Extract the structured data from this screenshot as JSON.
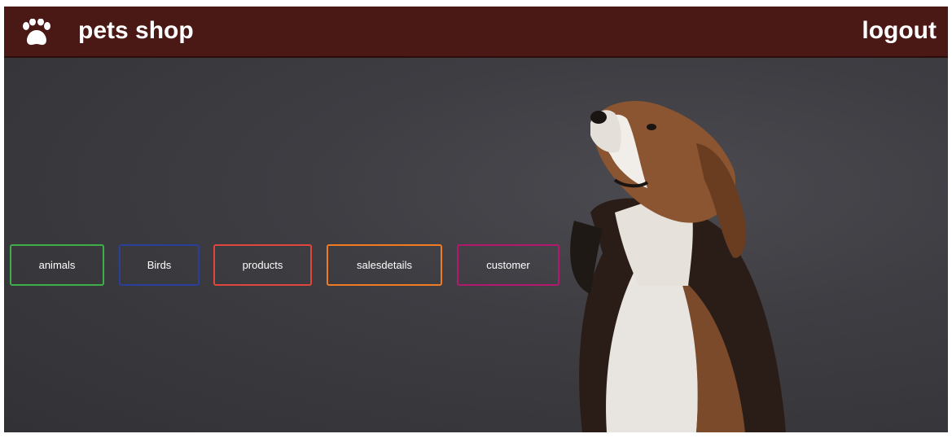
{
  "header": {
    "logo_icon": "paw-icon",
    "title": "pets shop",
    "logout_label": "logout",
    "background": "#4a1815"
  },
  "nav": {
    "buttons": [
      {
        "label": "animals",
        "border": "#3fae49"
      },
      {
        "label": "Birds",
        "border": "#2a3f9a"
      },
      {
        "label": "products",
        "border": "#e0473c"
      },
      {
        "label": "salesdetails",
        "border": "#f07b22"
      },
      {
        "label": "customer",
        "border": "#b2196e"
      }
    ]
  },
  "hero": {
    "image": "beagle-dog-photo"
  }
}
